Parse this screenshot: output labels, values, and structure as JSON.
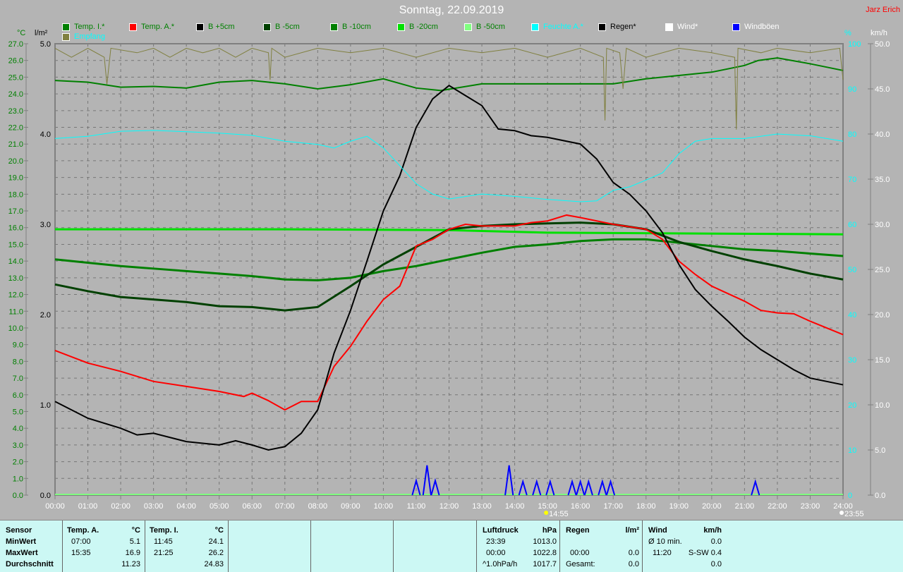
{
  "title": "Sonntag, 22.09.2019",
  "author": "Jarz Erich",
  "legend": [
    {
      "label": "Temp. I.*",
      "color": "#008000",
      "text": "#008000"
    },
    {
      "label": "Temp. A.*",
      "color": "#ff0000",
      "text": "#008000"
    },
    {
      "label": "B +5cm",
      "color": "#000000",
      "text": "#008000"
    },
    {
      "label": "B -5cm",
      "color": "#004000",
      "text": "#008000"
    },
    {
      "label": "B -10cm",
      "color": "#008000",
      "text": "#008000"
    },
    {
      "label": "B -20cm",
      "color": "#00e000",
      "text": "#008000"
    },
    {
      "label": "B -50cm",
      "color": "#80ff80",
      "text": "#008000"
    },
    {
      "label": "Feuchte A.*",
      "color": "#00ffff",
      "text": "#00ffff"
    },
    {
      "label": "Regen*",
      "color": "#000000",
      "text": "#000000"
    },
    {
      "label": "Wind*",
      "color": "#ffffff",
      "text": "#ffffff"
    },
    {
      "label": "Windböen",
      "color": "#0000ff",
      "text": "#ffffff"
    },
    {
      "label": "Empfang",
      "color": "#808040",
      "text": "#00ffff"
    }
  ],
  "chart_data": {
    "type": "line",
    "title": "Sonntag, 22.09.2019",
    "axes": {
      "temp": {
        "label": "°C",
        "range": [
          0,
          27
        ],
        "step": 1
      },
      "rain": {
        "label": "l/m²",
        "range": [
          0,
          5
        ],
        "ticks": [
          "0.0",
          "1.0",
          "2.0",
          "3.0",
          "4.0",
          "5.0"
        ]
      },
      "humidity": {
        "label": "%",
        "range": [
          0,
          100
        ],
        "ticks": [
          "0",
          "10",
          "20",
          "30",
          "40",
          "50",
          "60",
          "70",
          "80",
          "90",
          "100"
        ]
      },
      "wind": {
        "label": "km/h",
        "range": [
          0,
          50
        ],
        "ticks": [
          "0.0",
          "5.0",
          "10.0",
          "15.0",
          "20.0",
          "25.0",
          "30.0",
          "35.0",
          "40.0",
          "45.0",
          "50.0"
        ]
      }
    },
    "x_ticks": [
      "00:00",
      "01:00",
      "02:00",
      "03:00",
      "04:00",
      "05:00",
      "06:00",
      "07:00",
      "08:00",
      "09:00",
      "10:00",
      "11:00",
      "12:00",
      "13:00",
      "14:00",
      "15:00",
      "16:00",
      "17:00",
      "18:00",
      "19:00",
      "20:00",
      "21:00",
      "22:00",
      "23:00",
      "24:00"
    ],
    "sunrise": "14:55",
    "sunset": "23:55",
    "series": [
      {
        "name": "Temp. I.*",
        "axis": "temp",
        "color": "#008000",
        "points": [
          [
            0,
            24.8
          ],
          [
            1,
            24.7
          ],
          [
            2,
            24.4
          ],
          [
            3,
            24.45
          ],
          [
            4,
            24.35
          ],
          [
            5,
            24.7
          ],
          [
            6,
            24.8
          ],
          [
            7,
            24.6
          ],
          [
            8,
            24.3
          ],
          [
            9,
            24.55
          ],
          [
            10,
            24.9
          ],
          [
            11,
            24.35
          ],
          [
            11.75,
            24.2
          ],
          [
            13,
            24.6
          ],
          [
            15,
            24.6
          ],
          [
            17,
            24.6
          ],
          [
            18,
            24.9
          ],
          [
            19,
            25.1
          ],
          [
            20,
            25.3
          ],
          [
            21,
            25.7
          ],
          [
            21.42,
            26.0
          ],
          [
            22,
            26.15
          ],
          [
            23,
            25.8
          ],
          [
            24,
            25.4
          ]
        ]
      },
      {
        "name": "B -20cm",
        "axis": "temp",
        "color": "#00e000",
        "points": [
          [
            0,
            15.9
          ],
          [
            7,
            15.9
          ],
          [
            12,
            15.85
          ],
          [
            13,
            15.8
          ],
          [
            15,
            15.7
          ],
          [
            24,
            15.6
          ]
        ]
      },
      {
        "name": "B -10cm",
        "axis": "temp",
        "color": "#008000",
        "points": [
          [
            0,
            14.1
          ],
          [
            1,
            13.9
          ],
          [
            2,
            13.7
          ],
          [
            3,
            13.55
          ],
          [
            4,
            13.4
          ],
          [
            5,
            13.25
          ],
          [
            6,
            13.1
          ],
          [
            7,
            12.9
          ],
          [
            8,
            12.85
          ],
          [
            9,
            13.0
          ],
          [
            10,
            13.4
          ],
          [
            11,
            13.7
          ],
          [
            12,
            14.1
          ],
          [
            13,
            14.5
          ],
          [
            14,
            14.85
          ],
          [
            15,
            15.0
          ],
          [
            16,
            15.2
          ],
          [
            17,
            15.3
          ],
          [
            18,
            15.3
          ],
          [
            19,
            15.1
          ],
          [
            20,
            14.9
          ],
          [
            21,
            14.7
          ],
          [
            22,
            14.6
          ],
          [
            23,
            14.45
          ],
          [
            24,
            14.3
          ]
        ]
      },
      {
        "name": "B -5cm",
        "axis": "temp",
        "color": "#004000",
        "points": [
          [
            0,
            12.6
          ],
          [
            1,
            12.2
          ],
          [
            2,
            11.85
          ],
          [
            3,
            11.7
          ],
          [
            4,
            11.55
          ],
          [
            5,
            11.3
          ],
          [
            6,
            11.25
          ],
          [
            7,
            11.05
          ],
          [
            8,
            11.25
          ],
          [
            9,
            12.5
          ],
          [
            10,
            13.8
          ],
          [
            11,
            14.85
          ],
          [
            12,
            15.9
          ],
          [
            13,
            16.1
          ],
          [
            14,
            16.2
          ],
          [
            16,
            16.3
          ],
          [
            17,
            16.2
          ],
          [
            18,
            15.9
          ],
          [
            19,
            15.15
          ],
          [
            20,
            14.6
          ],
          [
            21,
            14.1
          ],
          [
            22,
            13.7
          ],
          [
            23,
            13.25
          ],
          [
            24,
            12.9
          ]
        ]
      },
      {
        "name": "Temp. A.*",
        "axis": "temp",
        "color": "#ff0000",
        "points": [
          [
            0,
            8.65
          ],
          [
            1,
            7.9
          ],
          [
            2,
            7.4
          ],
          [
            3,
            6.8
          ],
          [
            4,
            6.5
          ],
          [
            5,
            6.2
          ],
          [
            5.75,
            5.9
          ],
          [
            6,
            6.1
          ],
          [
            6.5,
            5.65
          ],
          [
            7,
            5.1
          ],
          [
            7.5,
            5.6
          ],
          [
            8,
            5.6
          ],
          [
            8.5,
            7.7
          ],
          [
            9,
            8.9
          ],
          [
            9.5,
            10.4
          ],
          [
            10,
            11.7
          ],
          [
            10.5,
            12.5
          ],
          [
            11,
            14.9
          ],
          [
            11.5,
            15.3
          ],
          [
            12,
            15.9
          ],
          [
            12.5,
            16.2
          ],
          [
            13,
            16.1
          ],
          [
            14,
            16.1
          ],
          [
            14.5,
            16.3
          ],
          [
            15,
            16.4
          ],
          [
            15.58,
            16.75
          ],
          [
            16,
            16.6
          ],
          [
            17,
            16.2
          ],
          [
            18,
            15.9
          ],
          [
            18.5,
            15.3
          ],
          [
            19,
            14.0
          ],
          [
            19.5,
            13.2
          ],
          [
            20,
            12.5
          ],
          [
            21,
            11.6
          ],
          [
            21.5,
            11.05
          ],
          [
            22,
            10.9
          ],
          [
            22.5,
            10.85
          ],
          [
            23,
            10.4
          ],
          [
            23.5,
            10.0
          ],
          [
            24,
            9.6
          ]
        ]
      },
      {
        "name": "B +5cm",
        "axis": "temp",
        "color": "#000000",
        "points": [
          [
            0,
            5.6
          ],
          [
            1,
            4.6
          ],
          [
            2,
            4.0
          ],
          [
            2.5,
            3.6
          ],
          [
            3,
            3.7
          ],
          [
            4,
            3.2
          ],
          [
            5,
            3.0
          ],
          [
            5.5,
            3.25
          ],
          [
            6,
            3.0
          ],
          [
            6.5,
            2.7
          ],
          [
            7,
            2.9
          ],
          [
            7.5,
            3.7
          ],
          [
            8,
            5.1
          ],
          [
            8.5,
            8.5
          ],
          [
            9,
            11.05
          ],
          [
            9.5,
            14.0
          ],
          [
            10,
            17.0
          ],
          [
            10.5,
            19.1
          ],
          [
            11,
            22.0
          ],
          [
            11.5,
            23.7
          ],
          [
            12,
            24.5
          ],
          [
            12.5,
            23.9
          ],
          [
            13,
            23.3
          ],
          [
            13.5,
            21.9
          ],
          [
            14,
            21.8
          ],
          [
            14.5,
            21.5
          ],
          [
            15,
            21.4
          ],
          [
            16,
            21.0
          ],
          [
            16.5,
            20.1
          ],
          [
            17,
            18.7
          ],
          [
            17.5,
            18.0
          ],
          [
            18,
            17.0
          ],
          [
            18.5,
            15.7
          ],
          [
            19,
            13.8
          ],
          [
            19.5,
            12.3
          ],
          [
            20,
            11.3
          ],
          [
            20.5,
            10.4
          ],
          [
            21,
            9.45
          ],
          [
            21.5,
            8.7
          ],
          [
            22,
            8.1
          ],
          [
            22.5,
            7.5
          ],
          [
            23,
            7.0
          ],
          [
            23.5,
            6.8
          ],
          [
            24,
            6.6
          ]
        ]
      },
      {
        "name": "Feuchte A.*",
        "axis": "humidity",
        "color": "#00ffff",
        "points": [
          [
            0,
            79
          ],
          [
            1,
            79.5
          ],
          [
            2,
            80.6
          ],
          [
            3,
            80.8
          ],
          [
            4,
            80.5
          ],
          [
            5,
            80.2
          ],
          [
            6,
            79.7
          ],
          [
            7,
            78.4
          ],
          [
            8,
            77.7
          ],
          [
            8.5,
            76.9
          ],
          [
            9,
            78.4
          ],
          [
            9.5,
            79.5
          ],
          [
            10,
            76.9
          ],
          [
            10.5,
            73
          ],
          [
            11,
            69
          ],
          [
            11.5,
            66.7
          ],
          [
            12,
            65.6
          ],
          [
            13,
            66.7
          ],
          [
            14,
            66.2
          ],
          [
            15,
            65.5
          ],
          [
            16,
            65
          ],
          [
            16.5,
            65.2
          ],
          [
            17,
            67.5
          ],
          [
            17.5,
            68.3
          ],
          [
            18,
            69.8
          ],
          [
            18.5,
            71.4
          ],
          [
            19,
            75.6
          ],
          [
            19.5,
            78.4
          ],
          [
            20,
            79
          ],
          [
            21,
            79
          ],
          [
            22,
            80
          ],
          [
            23,
            79.6
          ],
          [
            24,
            78.4
          ]
        ]
      },
      {
        "name": "Empfang",
        "axis": "humidity",
        "color": "#808040",
        "points": [
          [
            0,
            99
          ],
          [
            0.5,
            97
          ],
          [
            1,
            99
          ],
          [
            1.5,
            97
          ],
          [
            1.58,
            91
          ],
          [
            1.7,
            99
          ],
          [
            2.5,
            98
          ],
          [
            3,
            99
          ],
          [
            3.5,
            97
          ],
          [
            4,
            99
          ],
          [
            4.5,
            98
          ],
          [
            5,
            99
          ],
          [
            5.5,
            97
          ],
          [
            6,
            99
          ],
          [
            6.5,
            98
          ],
          [
            6.55,
            92
          ],
          [
            6.6,
            99
          ],
          [
            7,
            97
          ],
          [
            8,
            99
          ],
          [
            9,
            98
          ],
          [
            10,
            99
          ],
          [
            11,
            97
          ],
          [
            12,
            99
          ],
          [
            13,
            98
          ],
          [
            14,
            99
          ],
          [
            15,
            97
          ],
          [
            16,
            99
          ],
          [
            16.7,
            97
          ],
          [
            16.75,
            83
          ],
          [
            16.8,
            99
          ],
          [
            17.2,
            98
          ],
          [
            17.3,
            90
          ],
          [
            17.4,
            99
          ],
          [
            18,
            97
          ],
          [
            19,
            99
          ],
          [
            20,
            98
          ],
          [
            20.7,
            97
          ],
          [
            20.75,
            81
          ],
          [
            20.8,
            99
          ],
          [
            21.5,
            98
          ],
          [
            22,
            99
          ],
          [
            23,
            98
          ],
          [
            23.9,
            99
          ],
          [
            24,
            92
          ]
        ]
      },
      {
        "name": "Windböen",
        "axis": "wind",
        "color": "#0000ff",
        "peaks": [
          [
            11,
            1.6
          ],
          [
            11.33,
            3.3
          ],
          [
            11.58,
            1.6
          ],
          [
            13.83,
            3.3
          ],
          [
            14.25,
            1.5
          ],
          [
            14.67,
            1.5
          ],
          [
            15.08,
            1.5
          ],
          [
            15.75,
            1.5
          ],
          [
            16,
            1.5
          ],
          [
            16.25,
            1.5
          ],
          [
            16.67,
            1.5
          ],
          [
            16.92,
            1.5
          ],
          [
            21.33,
            1.5
          ]
        ]
      }
    ]
  },
  "table": {
    "sensor": {
      "h": "Sensor",
      "min": "MinWert",
      "max": "MaxWert",
      "avg": "Durchschnitt"
    },
    "tempA": {
      "h": "Temp. A.",
      "u": "°C",
      "minT": "07:00",
      "min": "5.1",
      "maxT": "15:35",
      "max": "16.9",
      "avg": "11.23"
    },
    "tempI": {
      "h": "Temp. I.",
      "u": "°C",
      "minT": "11:45",
      "min": "24.1",
      "maxT": "21:25",
      "max": "26.2",
      "avg": "24.83"
    },
    "press": {
      "h": "Luftdruck",
      "u": "hPa",
      "r1a": "23:39",
      "r1b": "1013.0",
      "r2a": "00:00",
      "r2b": "1022.8",
      "r3a": "^1.0hPa/h",
      "r3b": "1017.7"
    },
    "rain": {
      "h": "Regen",
      "u": "l/m²",
      "r2a": "00:00",
      "r2b": "0.0",
      "r3a": "Gesamt:",
      "r3b": "0.0"
    },
    "wind": {
      "h": "Wind",
      "u": "km/h",
      "r1a": "Ø 10 min.",
      "r1b": "0.0",
      "r2a": "11:20",
      "r2b": "S-SW 0.4",
      "r3b": "0.0"
    }
  }
}
